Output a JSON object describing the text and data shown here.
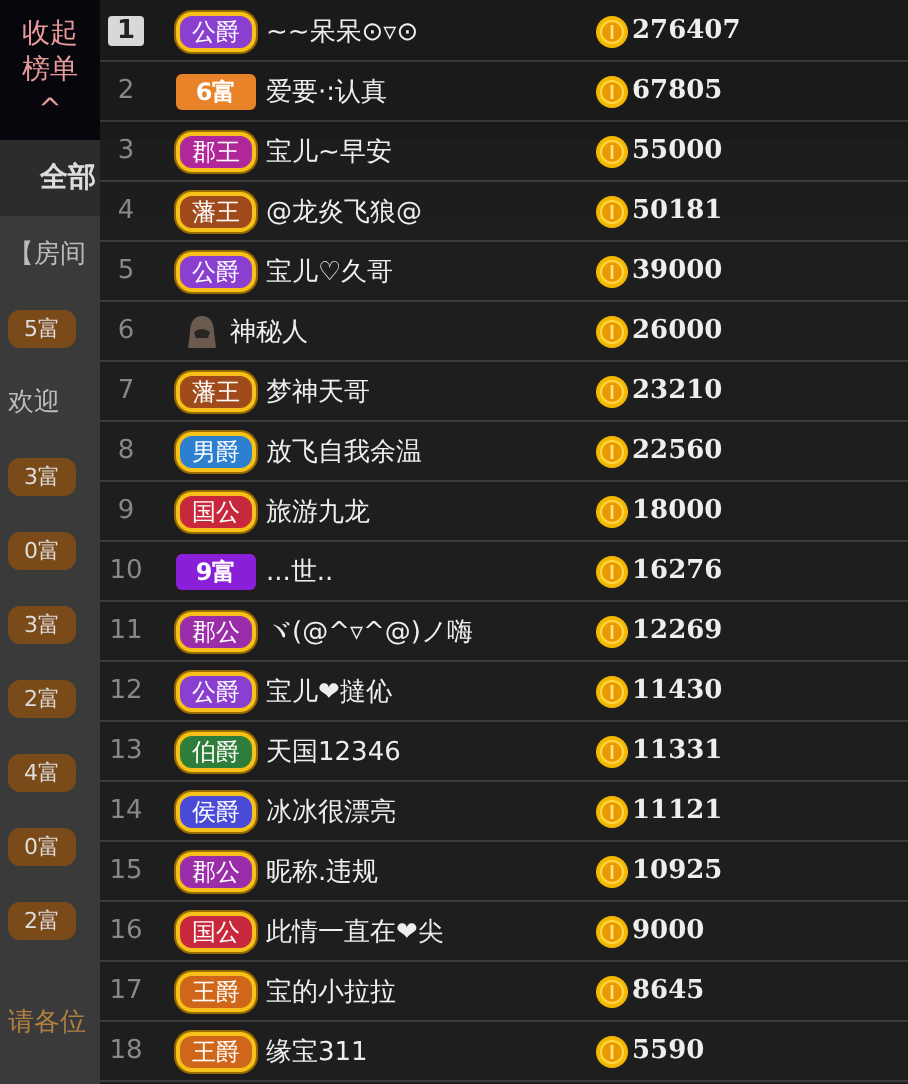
{
  "room": {
    "tabs": [
      {
        "label": "全部",
        "selected": true
      }
    ],
    "announcement": "【房间",
    "chat": [
      {
        "badge": "5富"
      },
      {
        "text": "欢迎"
      },
      {
        "badge": "3富"
      },
      {
        "badge": "0富"
      },
      {
        "badge": "3富"
      },
      {
        "badge": "2富"
      },
      {
        "badge": "4富"
      },
      {
        "badge": "0富"
      },
      {
        "badge": "2富"
      }
    ],
    "notice": "请各位"
  },
  "collapse_button": {
    "label": "收起榜单",
    "caret": "^"
  },
  "ranking": [
    {
      "rank": "1",
      "top": true,
      "kind": "noble",
      "badge": "公爵",
      "color": "#8a3fd0",
      "name": "~~呆呆⊙▿⊙",
      "amount": "276407"
    },
    {
      "rank": "2",
      "top": false,
      "kind": "wealth",
      "badge": "6富",
      "color": "#e8832a",
      "name": "爱要·:认真",
      "amount": "67805"
    },
    {
      "rank": "3",
      "top": false,
      "kind": "noble",
      "badge": "郡王",
      "color": "#b0279a",
      "name": "宝儿~早安",
      "amount": "55000"
    },
    {
      "rank": "4",
      "top": false,
      "kind": "noble",
      "badge": "藩王",
      "color": "#a04a1c",
      "name": "@龙炎飞狼@",
      "amount": "50181"
    },
    {
      "rank": "5",
      "top": false,
      "kind": "noble",
      "badge": "公爵",
      "color": "#8a3fd0",
      "name": "宝儿♡久哥",
      "amount": "39000"
    },
    {
      "rank": "6",
      "top": false,
      "kind": "mystery",
      "name": "神秘人",
      "amount": "26000"
    },
    {
      "rank": "7",
      "top": false,
      "kind": "noble",
      "badge": "藩王",
      "color": "#a04a1c",
      "name": "梦神天哥",
      "amount": "23210"
    },
    {
      "rank": "8",
      "top": false,
      "kind": "noble",
      "badge": "男爵",
      "color": "#2d7fd0",
      "name": "放飞自我余温",
      "amount": "22560"
    },
    {
      "rank": "9",
      "top": false,
      "kind": "noble",
      "badge": "国公",
      "color": "#c8283c",
      "name": "旅游九龙",
      "amount": "18000"
    },
    {
      "rank": "10",
      "top": false,
      "kind": "wealth",
      "badge": "9富",
      "color": "#8a1fd8",
      "name": "...世..",
      "amount": "16276"
    },
    {
      "rank": "11",
      "top": false,
      "kind": "noble",
      "badge": "郡公",
      "color": "#9a2ea8",
      "name": "ヾ(@^▿^@)ノ嗨",
      "amount": "12269"
    },
    {
      "rank": "12",
      "top": false,
      "kind": "noble",
      "badge": "公爵",
      "color": "#8a3fd0",
      "name": "宝儿❤撻伈",
      "amount": "11430"
    },
    {
      "rank": "13",
      "top": false,
      "kind": "noble",
      "badge": "伯爵",
      "color": "#2e7d3a",
      "name": "天国12346",
      "amount": "11331"
    },
    {
      "rank": "14",
      "top": false,
      "kind": "noble",
      "badge": "侯爵",
      "color": "#4a4ad8",
      "name": "冰冰很漂亮",
      "amount": "11121"
    },
    {
      "rank": "15",
      "top": false,
      "kind": "noble",
      "badge": "郡公",
      "color": "#9a2ea8",
      "name": "昵称.违规",
      "amount": "10925"
    },
    {
      "rank": "16",
      "top": false,
      "kind": "noble",
      "badge": "国公",
      "color": "#c8283c",
      "name": "此情一直在❤尖",
      "amount": "9000"
    },
    {
      "rank": "17",
      "top": false,
      "kind": "noble",
      "badge": "王爵",
      "color": "#d0661a",
      "name": "宝的小拉拉",
      "amount": "8645"
    },
    {
      "rank": "18",
      "top": false,
      "kind": "noble",
      "badge": "王爵",
      "color": "#d0661a",
      "name": "缘宝311",
      "amount": "5590"
    }
  ]
}
